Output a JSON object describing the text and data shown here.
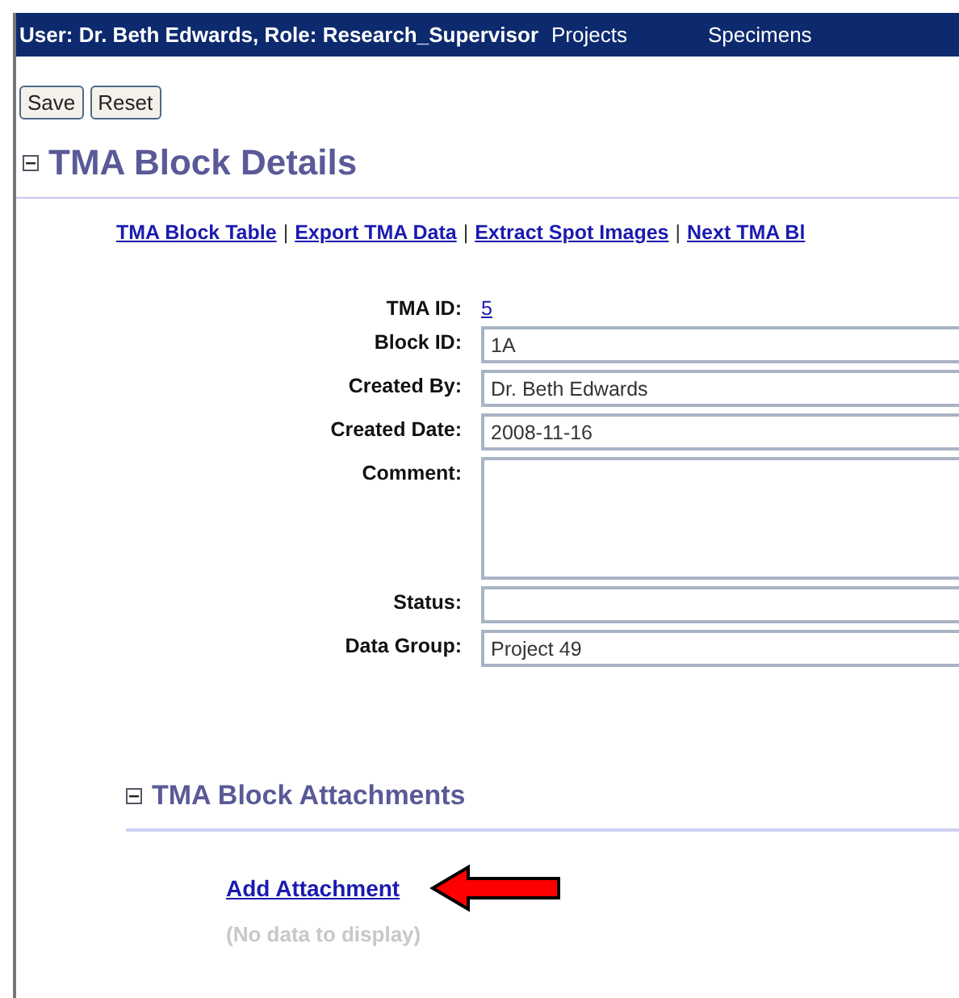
{
  "top_bar": {
    "user": "User: Dr. Beth Edwards, Role: Research_Supervisor",
    "menu": [
      "Projects",
      "Specimens"
    ]
  },
  "buttons": [
    "Save",
    "Reset"
  ],
  "section": {
    "title": "TMA Block Details",
    "expanded": true
  },
  "links": [
    "TMA Block Table",
    "Export TMA Data",
    "Extract Spot Images",
    "Next TMA Bl"
  ],
  "link_separator": "|",
  "fields": [
    {
      "label": "TMA ID:",
      "kind": "link",
      "value": "5"
    },
    {
      "label": "Block ID:",
      "kind": "input",
      "value": "1A"
    },
    {
      "label": "Created By:",
      "kind": "input",
      "value": "Dr. Beth Edwards"
    },
    {
      "label": "Created Date:",
      "kind": "input",
      "value": "2008-11-16"
    },
    {
      "label": "Comment:",
      "kind": "textarea"
    },
    {
      "label": "Status:",
      "kind": "input"
    },
    {
      "label": "Data Group:",
      "kind": "input",
      "value": "Project 49"
    }
  ],
  "attachments": {
    "title": "TMA Block Attachments",
    "expanded": true,
    "add_link": "Add Attachment",
    "empty_text": "(No data to display)"
  }
}
